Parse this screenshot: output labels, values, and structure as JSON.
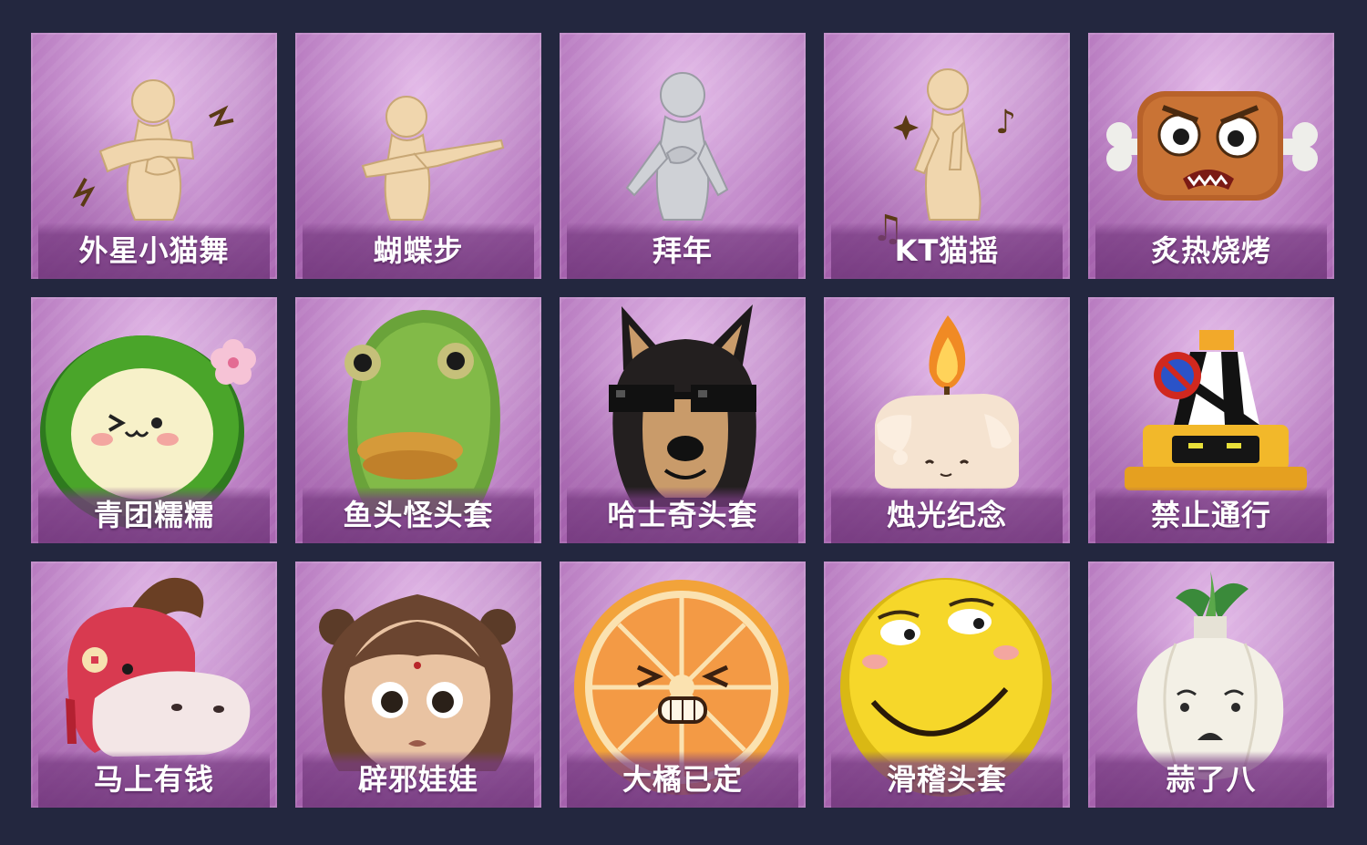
{
  "items": [
    {
      "label": "外星小猫舞",
      "icon": "alien-cat-dance-emote-icon"
    },
    {
      "label": "蝴蝶步",
      "icon": "butterfly-step-emote-icon"
    },
    {
      "label": "拜年",
      "icon": "new-year-greeting-emote-icon"
    },
    {
      "label": "KT猫摇",
      "icon": "kt-cat-sway-emote-icon"
    },
    {
      "label": "炙热烧烤",
      "icon": "meat-bone-head-icon"
    },
    {
      "label": "青团糯糯",
      "icon": "green-rice-ball-head-icon"
    },
    {
      "label": "鱼头怪头套",
      "icon": "fish-head-mask-icon"
    },
    {
      "label": "哈士奇头套",
      "icon": "husky-sunglasses-mask-icon"
    },
    {
      "label": "烛光纪念",
      "icon": "candle-head-icon"
    },
    {
      "label": "禁止通行",
      "icon": "traffic-cone-head-icon"
    },
    {
      "label": "马上有钱",
      "icon": "red-horse-head-icon"
    },
    {
      "label": "辟邪娃娃",
      "icon": "doll-girl-head-icon"
    },
    {
      "label": "大橘已定",
      "icon": "orange-slice-head-icon"
    },
    {
      "label": "滑稽头套",
      "icon": "funny-face-mask-icon"
    },
    {
      "label": "蒜了八",
      "icon": "garlic-head-icon"
    }
  ],
  "colors": {
    "background": "#23273f",
    "card": "#c893d0",
    "label_text": "#ffffff"
  }
}
